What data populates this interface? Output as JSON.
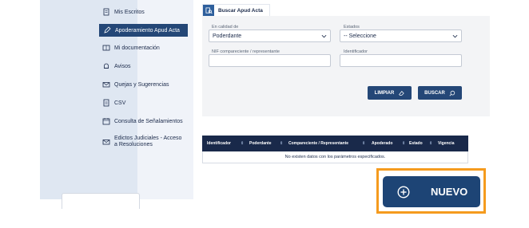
{
  "sidebar": {
    "items": [
      {
        "label": "Mis Escritos",
        "icon": "document-icon"
      },
      {
        "label": "Apoderamiento Apud Acta",
        "icon": "pen-icon",
        "active": true
      },
      {
        "label": "Mi documentación",
        "icon": "book-icon"
      },
      {
        "label": "Avisos",
        "icon": "bell-icon"
      },
      {
        "label": "Quejas y Sugerencias",
        "icon": "envelope-icon"
      },
      {
        "label": "CSV",
        "icon": "csv-icon"
      },
      {
        "label": "Consulta de Señalamientos",
        "icon": "calendar-icon"
      },
      {
        "label": "Edictos Judiciales - Acceso a Resoluciones",
        "icon": "mail-icon"
      }
    ]
  },
  "tab": {
    "label": "Buscar Apud Acta",
    "icon": "search-doc-icon"
  },
  "form": {
    "calidad_label": "En calidad de",
    "calidad_value": "Poderdante",
    "estados_label": "Estados",
    "estados_value": "-- Seleccione",
    "nif_label": "NIF compareciente / representante",
    "nif_value": "",
    "identificador_label": "Identificador",
    "identificador_value": "",
    "limpiar": "LIMPIAR",
    "buscar": "BUSCAR"
  },
  "table": {
    "headers": [
      "Identificador",
      "Poderdante",
      "Compareciente / Representante",
      "Apoderado",
      "Estado",
      "Vigencia"
    ],
    "empty_message": "No existen datos con los parámetros especificados."
  },
  "nuevo": {
    "label": "NUEVO"
  },
  "colors": {
    "primary": "#244777",
    "dark_header": "#19294a",
    "highlight": "#f59b1e"
  }
}
